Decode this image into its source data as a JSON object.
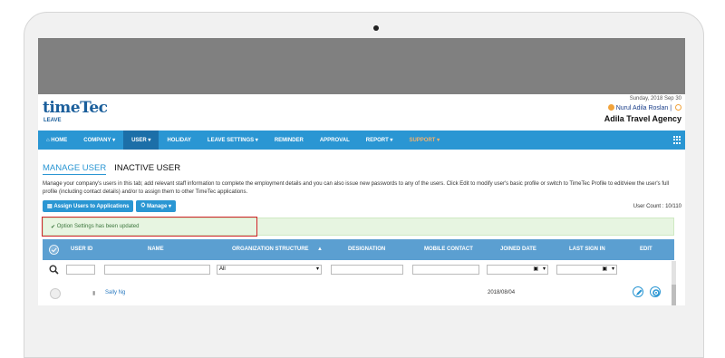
{
  "header": {
    "logo": "timeTec",
    "logo_sub": "LEAVE",
    "date": "Sunday, 2018 Sep 30",
    "user_name": "Nurul Adila Roslan",
    "company": "Adila Travel Agency"
  },
  "nav": {
    "items": [
      {
        "label": "HOME"
      },
      {
        "label": "COMPANY ▾"
      },
      {
        "label": "USER ▾"
      },
      {
        "label": "HOLIDAY"
      },
      {
        "label": "LEAVE SETTINGS ▾"
      },
      {
        "label": "REMINDER"
      },
      {
        "label": "APPROVAL"
      },
      {
        "label": "REPORT ▾"
      },
      {
        "label": "SUPPORT ▾"
      }
    ]
  },
  "tabs": {
    "manage": "MANAGE USER",
    "inactive": "INACTIVE USER"
  },
  "description": "Manage your company's users in this tab; add relevant staff information to complete the employment details and you can also issue new passwords to any of the users. Click Edit to modify user's basic profile or switch to TimeTec Profile to edit/view the user's full profile (including contact details) and/or to assign them to other TimeTec applications.",
  "toolbar": {
    "assign_label": "Assign Users to Applications",
    "manage_label": "Manage ▾"
  },
  "user_count": "User Count : 10/110",
  "alert": {
    "message": "Option Settings has been updated"
  },
  "table": {
    "columns": [
      "USER ID",
      "NAME",
      "ORGANIZATION STRUCTURE",
      "DESIGNATION",
      "MOBILE CONTACT",
      "JOINED DATE",
      "LAST SIGN IN",
      "EDIT"
    ],
    "org_filter_value": "All",
    "rows": [
      {
        "user_id": "",
        "name": "Sally Ng",
        "org": "",
        "designation": "",
        "mobile": "",
        "joined": "2018/08/04",
        "last_sign_in": ""
      }
    ]
  },
  "colors": {
    "nav_bg": "#2a96d3",
    "nav_active": "#1c6fa8",
    "header_row": "#5b9fd1",
    "alert_bg": "#e7f5e1",
    "highlight_border": "#d2232a"
  }
}
